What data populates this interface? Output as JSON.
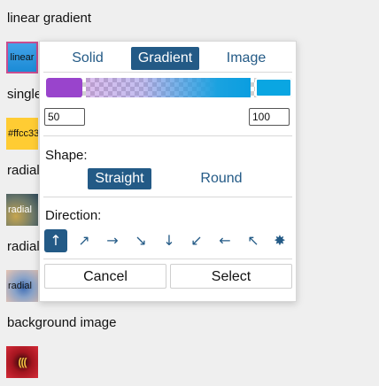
{
  "sections": [
    {
      "label": "linear gradient",
      "swatch_text": "linear"
    },
    {
      "label": "single",
      "swatch_text": "#ffcc33"
    },
    {
      "label": "radial",
      "swatch_text": "radial"
    },
    {
      "label": "radial",
      "swatch_text": "radial"
    },
    {
      "label": "background image",
      "swatch_text": "((("
    }
  ],
  "popup": {
    "tabs": {
      "solid": "Solid",
      "gradient": "Gradient",
      "image": "Image"
    },
    "gradient": {
      "start_color": "#9944cc",
      "end_color": "#0aa6e2",
      "start_position": "50",
      "end_position": "100"
    },
    "shape": {
      "label": "Shape:",
      "straight": "Straight",
      "round": "Round",
      "selected": "Straight"
    },
    "direction": {
      "label": "Direction:",
      "options": [
        "↑",
        "↗",
        "→",
        "↘",
        "↓",
        "↙",
        "←",
        "↖",
        "✸"
      ],
      "icons": [
        "arrow-up-icon",
        "arrow-up-right-icon",
        "arrow-right-icon",
        "arrow-down-right-icon",
        "arrow-down-icon",
        "arrow-down-left-icon",
        "arrow-left-icon",
        "arrow-up-left-icon",
        "radial-center-icon"
      ],
      "selected_index": 0
    },
    "actions": {
      "cancel": "Cancel",
      "select": "Select"
    }
  },
  "colors": {
    "accent": "#235a86",
    "swatch_single": "#ffcc33"
  }
}
